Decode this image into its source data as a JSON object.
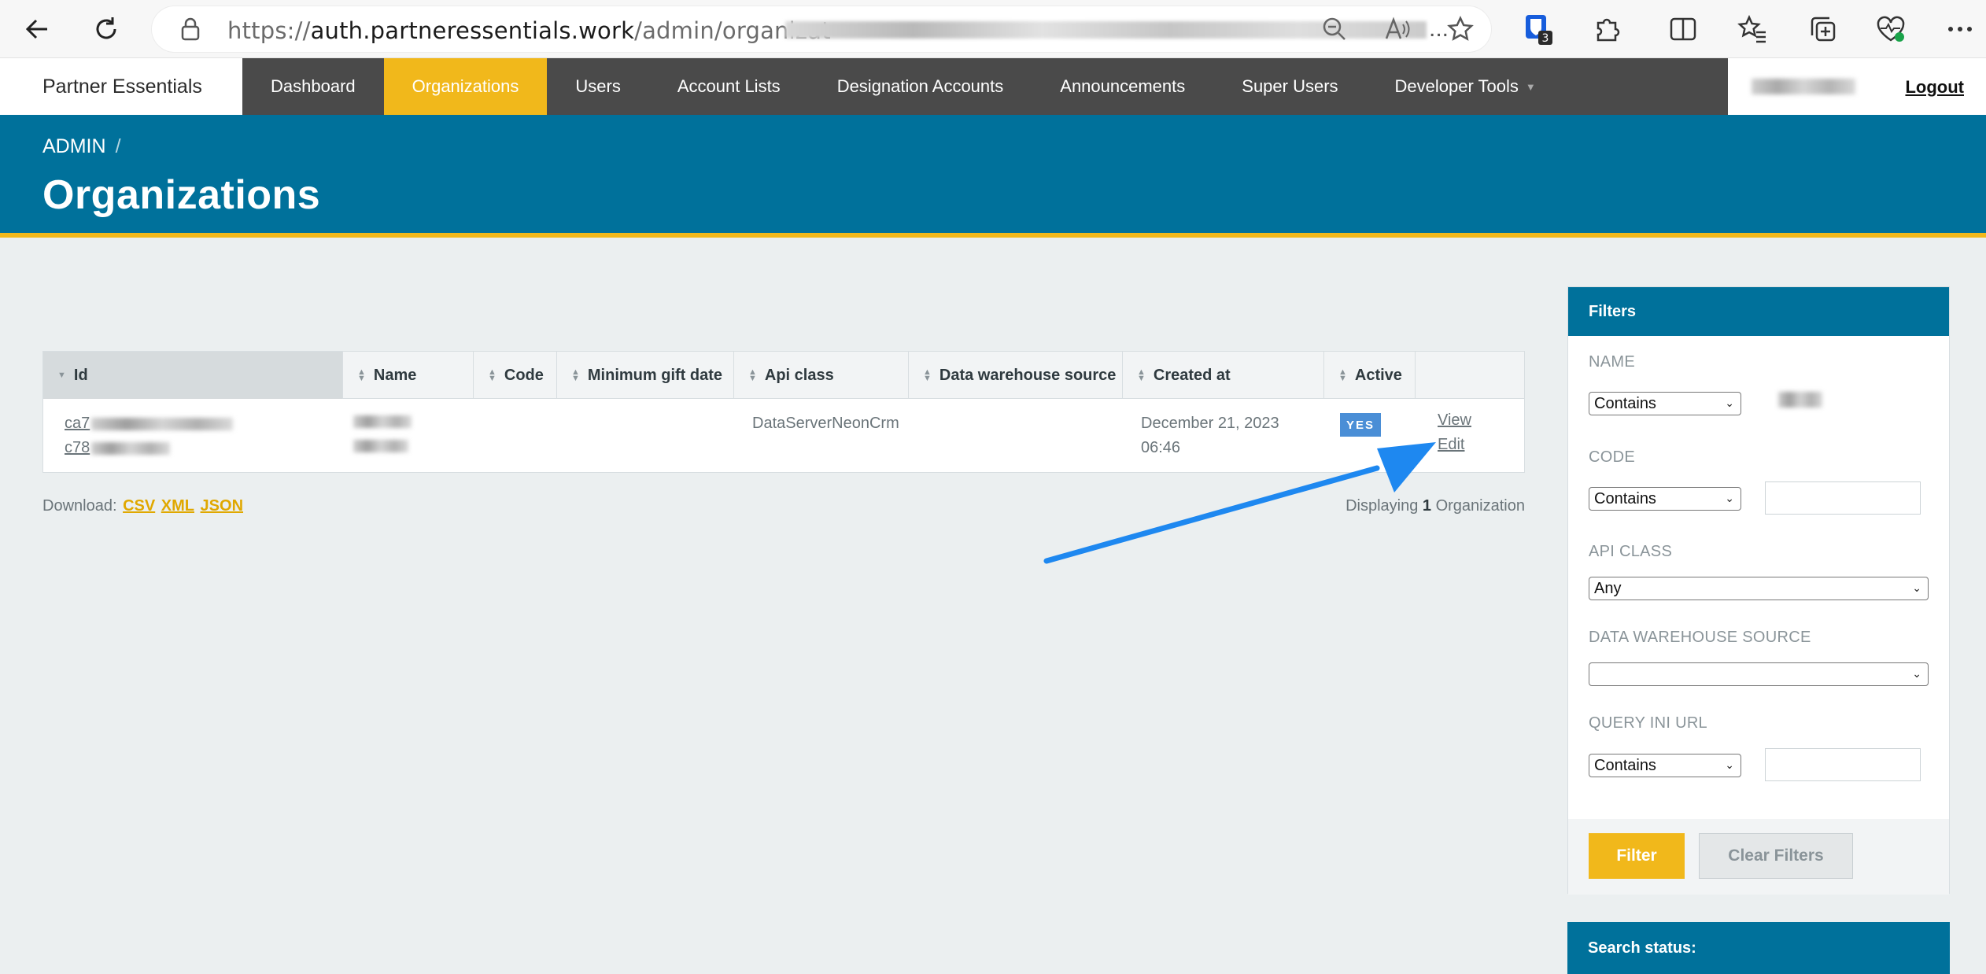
{
  "browser": {
    "url_prefix": "https://",
    "url_host": "auth.partneressentials.work",
    "url_path": "/admin/organizat",
    "url_ellipsis": "...",
    "extension_badge": "3"
  },
  "nav": {
    "brand": "Partner Essentials",
    "items": [
      {
        "label": "Dashboard",
        "active": false
      },
      {
        "label": "Organizations",
        "active": true
      },
      {
        "label": "Users",
        "active": false
      },
      {
        "label": "Account Lists",
        "active": false
      },
      {
        "label": "Designation Accounts",
        "active": false
      },
      {
        "label": "Announcements",
        "active": false
      },
      {
        "label": "Super Users",
        "active": false
      },
      {
        "label": "Developer Tools",
        "active": false
      }
    ],
    "logout": "Logout"
  },
  "header": {
    "breadcrumb": "ADMIN",
    "breadcrumb_sep": "/",
    "title": "Organizations"
  },
  "table": {
    "columns": [
      "Id",
      "Name",
      "Code",
      "Minimum gift date",
      "Api class",
      "Data warehouse source",
      "Created at",
      "Active"
    ],
    "row": {
      "id_line1": "ca7",
      "id_line2": "c78",
      "api_class": "DataServerNeonCrm",
      "created_at_line1": "December 21, 2023",
      "created_at_line2": "06:46",
      "active": "YES",
      "view": "View",
      "edit": "Edit"
    }
  },
  "footer": {
    "download_label": "Download:",
    "formats": [
      "CSV",
      "XML",
      "JSON"
    ],
    "displaying_prefix": "Displaying",
    "displaying_count": "1",
    "displaying_suffix": "Organization"
  },
  "filters": {
    "title": "Filters",
    "name_label": "NAME",
    "name_op": "Contains",
    "code_label": "CODE",
    "code_op": "Contains",
    "api_label": "API CLASS",
    "api_value": "Any",
    "dws_label": "DATA WAREHOUSE SOURCE",
    "dws_value": "",
    "query_label": "QUERY INI URL",
    "query_op": "Contains",
    "filter_btn": "Filter",
    "clear_btn": "Clear Filters"
  },
  "search_status": {
    "title": "Search status:"
  },
  "colors": {
    "accent_yellow": "#f1b81b",
    "header_blue": "#00719b",
    "nav_dark": "#4a4a4a",
    "badge_blue": "#4a8ed6",
    "annotation_arrow": "#1e88f0"
  }
}
